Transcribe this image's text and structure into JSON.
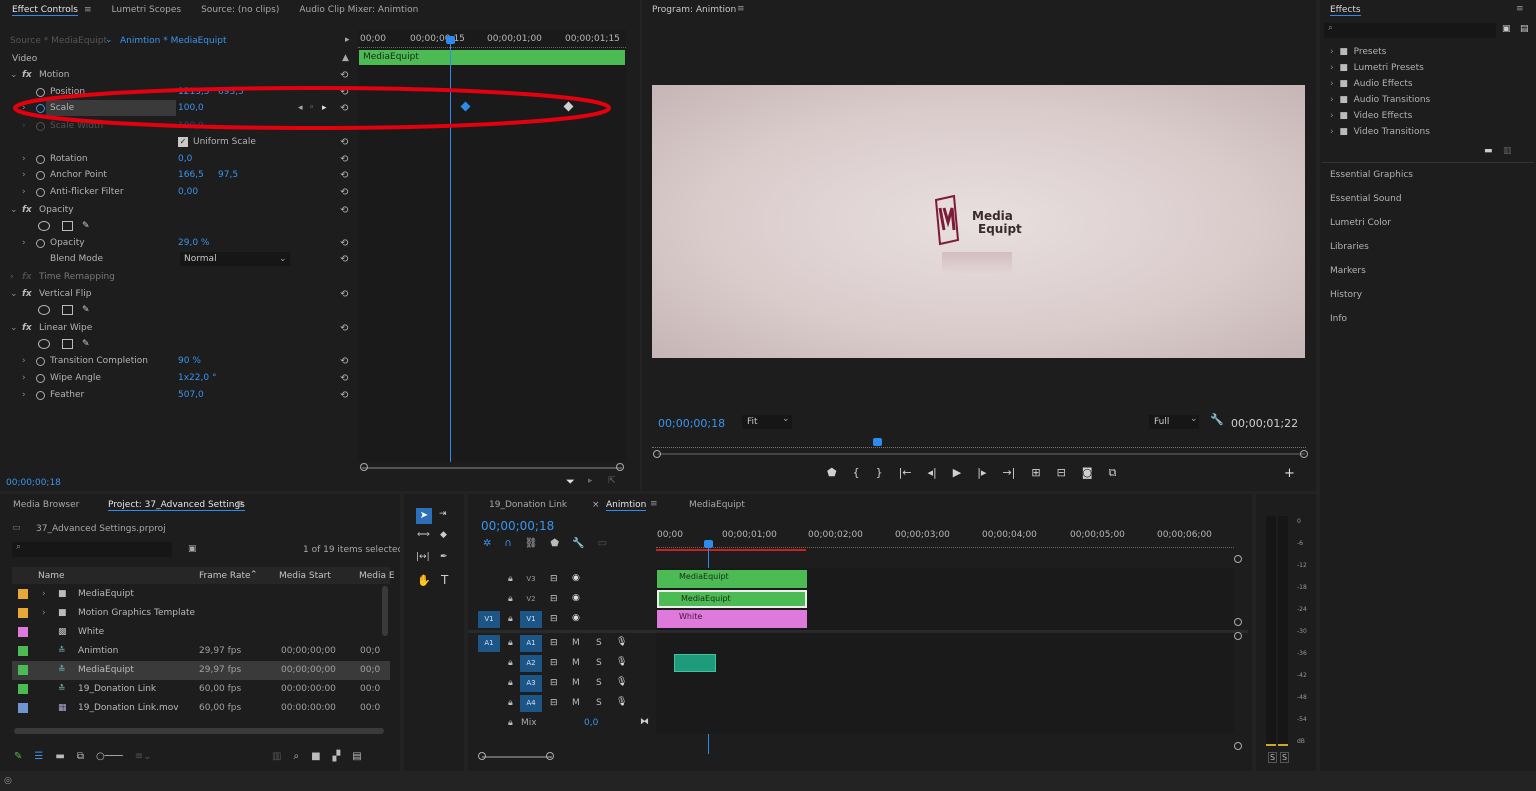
{
  "colors": {
    "accent": "#2d8ceb",
    "clip_green": "#4dbb54",
    "clip_pink": "#e079dc",
    "clip_teal": "#1e9b7a",
    "annotation_red": "#e3000f"
  },
  "effect_controls": {
    "tabs": [
      "Effect Controls",
      "Lumetri Scopes",
      "Source: (no clips)",
      "Audio Clip Mixer: Animtion"
    ],
    "source_label": "Source * MediaEquipt",
    "sequence_label": "Animtion * MediaEquipt",
    "section_video": "Video",
    "mini_ruler": [
      "00;00",
      "00;00;00;15",
      "00;00;01;00",
      "00;00;01;15"
    ],
    "clip_name": "MediaEquipt",
    "motion_label": "Motion",
    "position_label": "Position",
    "position_x": "1213,5",
    "position_y": "693,5",
    "scale_label": "Scale",
    "scale_value": "100,0",
    "scale_width_label": "Scale Width",
    "scale_width_value": "100,0",
    "uniform_scale": "Uniform Scale",
    "rotation_label": "Rotation",
    "rotation_value": "0,0",
    "anchor_label": "Anchor Point",
    "anchor_x": "166,5",
    "anchor_y": "97,5",
    "antiflicker_label": "Anti-flicker Filter",
    "antiflicker_value": "0,00",
    "opacity_group": "Opacity",
    "opacity_label": "Opacity",
    "opacity_value": "29,0 %",
    "blend_label": "Blend Mode",
    "blend_value": "Normal",
    "time_remap": "Time Remapping",
    "vflip": "Vertical Flip",
    "linear_wipe": "Linear Wipe",
    "transition_label": "Transition Completion",
    "transition_value": "90 %",
    "wipe_angle_label": "Wipe Angle",
    "wipe_angle_value": "1x22,0 °",
    "feather_label": "Feather",
    "feather_value": "507,0",
    "timecode": "00;00;00;18"
  },
  "program": {
    "title": "Program: Animtion",
    "logo_line1": "Media",
    "logo_line2": "Equipt",
    "timecode": "00;00;00;18",
    "fit": "Fit",
    "quality": "Full",
    "duration": "00;00;01;22"
  },
  "effects_panel": {
    "title": "Effects",
    "tree": [
      "Presets",
      "Lumetri Presets",
      "Audio Effects",
      "Audio Transitions",
      "Video Effects",
      "Video Transitions"
    ],
    "links": [
      "Essential Graphics",
      "Essential Sound",
      "Lumetri Color",
      "Libraries",
      "Markers",
      "History",
      "Info"
    ]
  },
  "project": {
    "tabs": [
      "Media Browser",
      "Project: 37_Advanced Settings"
    ],
    "file": "37_Advanced Settings.prproj",
    "count": "1 of 19 items selected",
    "columns": [
      "Name",
      "Frame Rate",
      "Media Start",
      "Media E"
    ],
    "rows": [
      {
        "name": "MediaEquipt",
        "fr": "",
        "ms": "",
        "me": "",
        "color": "#e8a838",
        "kind": "folder"
      },
      {
        "name": "Motion Graphics Template",
        "fr": "",
        "ms": "",
        "me": "",
        "color": "#e8a838",
        "kind": "folder"
      },
      {
        "name": "White",
        "fr": "",
        "ms": "",
        "me": "",
        "color": "#e079dc",
        "kind": "matte"
      },
      {
        "name": "Animtion",
        "fr": "29,97 fps",
        "ms": "00;00;00;00",
        "me": "00;0",
        "color": "#4dbb54",
        "kind": "seq"
      },
      {
        "name": "MediaEquipt",
        "fr": "29,97 fps",
        "ms": "00;00;00;00",
        "me": "00;0",
        "color": "#4dbb54",
        "kind": "seq"
      },
      {
        "name": "19_Donation Link",
        "fr": "60,00 fps",
        "ms": "00:00:00:00",
        "me": "00:0",
        "color": "#4dbb54",
        "kind": "seq"
      },
      {
        "name": "19_Donation Link.mov",
        "fr": "60,00 fps",
        "ms": "00:00:00:00",
        "me": "00:0",
        "color": "#6f97cf",
        "kind": "clip"
      }
    ]
  },
  "timeline": {
    "tabs": [
      "19_Donation Link",
      "Animtion",
      "MediaEquipt"
    ],
    "timecode": "00;00;00;18",
    "ruler": [
      "00;00",
      "00;00;01;00",
      "00;00;02;00",
      "00;00;03;00",
      "00;00;04;00",
      "00;00;05;00",
      "00;00;06;00"
    ],
    "video_tracks": [
      "V3",
      "V2",
      "V1"
    ],
    "audio_tracks": [
      "A1",
      "A2",
      "A3",
      "A4"
    ],
    "source_v": "V1",
    "source_a": "A1",
    "mix_label": "Mix",
    "mix_value": "0,0",
    "mute": "M",
    "solo": "S",
    "clips": {
      "v3": "MediaEquipt",
      "v2": "MediaEquipt",
      "v1": "White"
    }
  },
  "meter": {
    "scale": [
      "0",
      "-6",
      "-12",
      "-18",
      "-24",
      "-30",
      "-36",
      "-42",
      "-48",
      "-54",
      "dB"
    ],
    "solo": [
      "S",
      "S"
    ]
  }
}
